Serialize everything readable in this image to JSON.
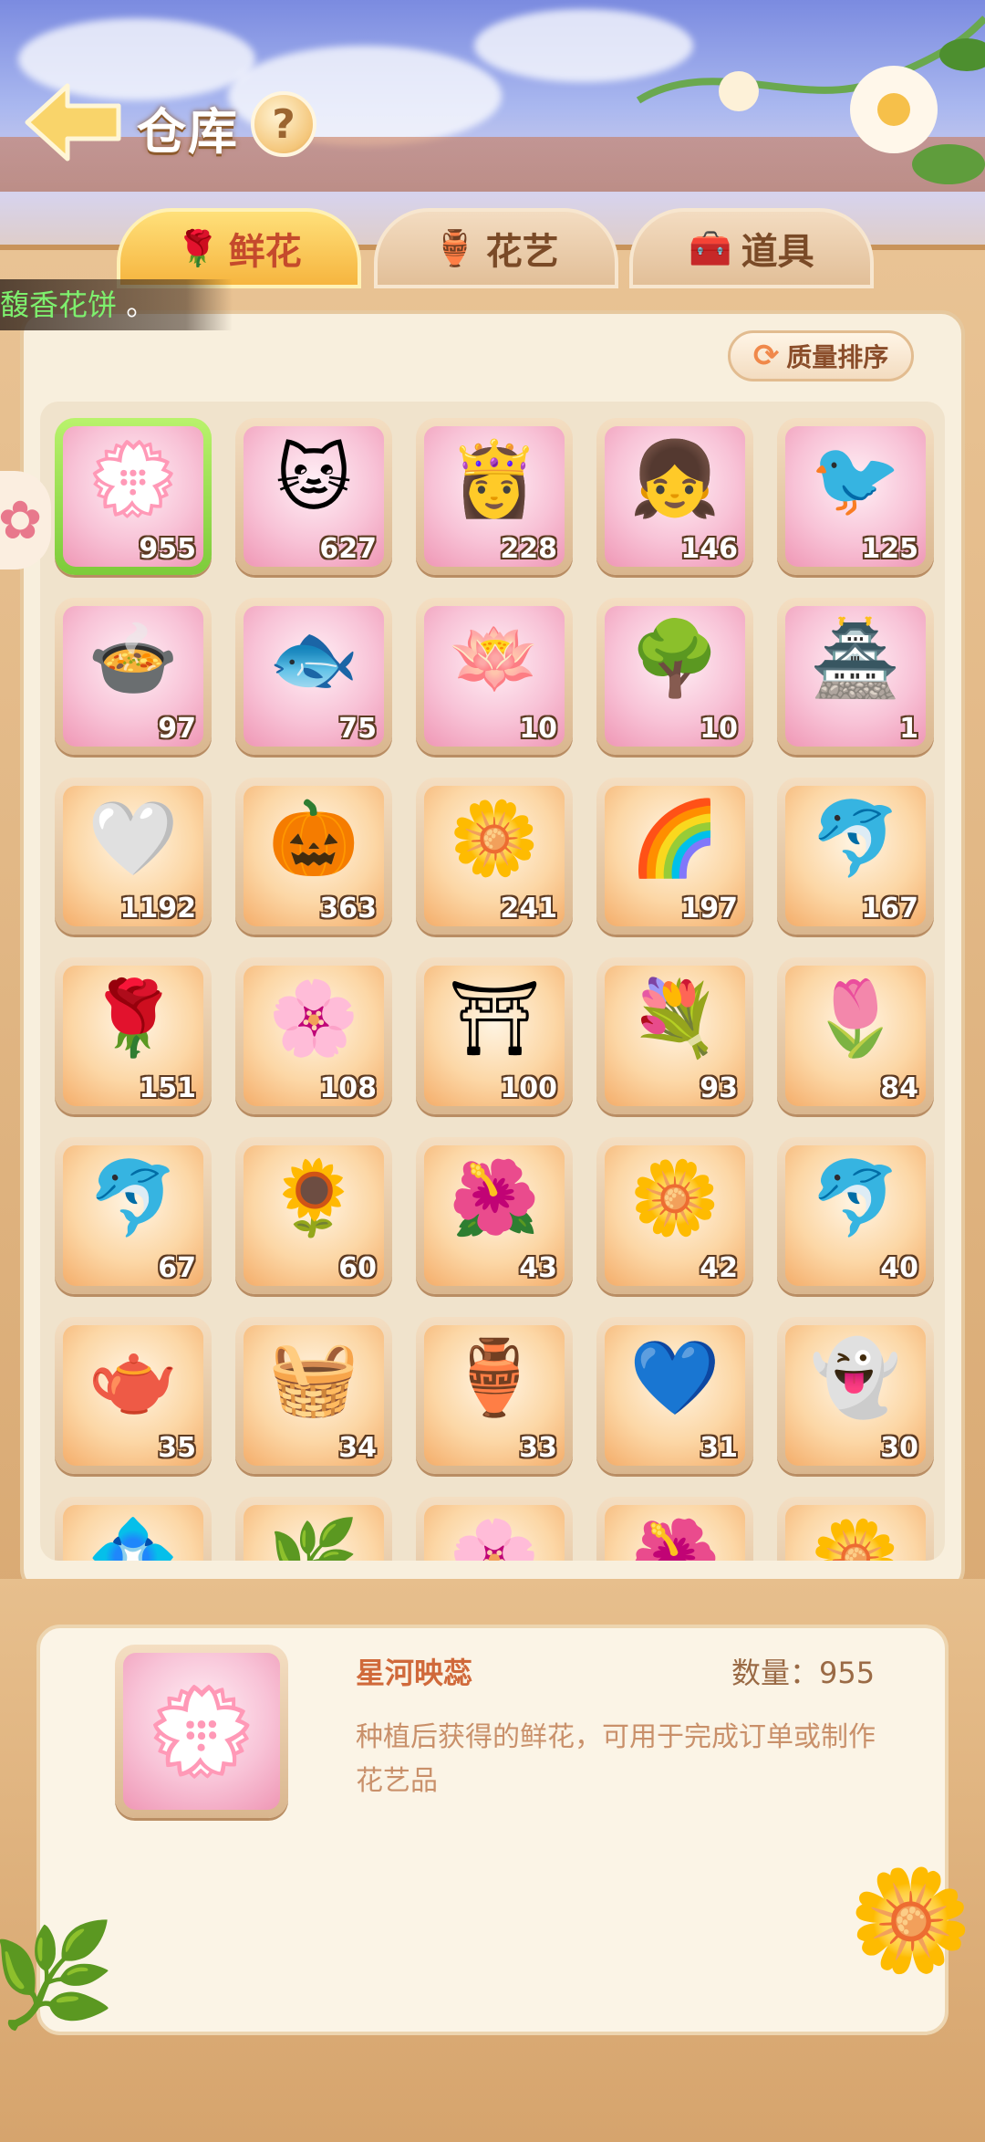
{
  "header": {
    "title": "仓库",
    "help": "?"
  },
  "tabs": [
    {
      "label": "鲜花",
      "icon": "🌹",
      "active": true
    },
    {
      "label": "花艺",
      "icon": "🏺",
      "active": false
    },
    {
      "label": "道具",
      "icon": "🧰",
      "active": false
    }
  ],
  "ticker": {
    "highlight": "馥香花饼",
    "suffix": " 。"
  },
  "sort_button": {
    "label": "质量排序"
  },
  "items": [
    {
      "count": "955",
      "emoji": "💮",
      "bg": "pink"
    },
    {
      "count": "627",
      "emoji": "🐱",
      "bg": "pink"
    },
    {
      "count": "228",
      "emoji": "👸",
      "bg": "pink"
    },
    {
      "count": "146",
      "emoji": "👧",
      "bg": "pink"
    },
    {
      "count": "125",
      "emoji": "🐦",
      "bg": "pink"
    },
    {
      "count": "97",
      "emoji": "🍲",
      "bg": "pink"
    },
    {
      "count": "75",
      "emoji": "🐟",
      "bg": "pink"
    },
    {
      "count": "10",
      "emoji": "🪷",
      "bg": "pink"
    },
    {
      "count": "10",
      "emoji": "🌳",
      "bg": "pink"
    },
    {
      "count": "1",
      "emoji": "🏯",
      "bg": "pink"
    },
    {
      "count": "1192",
      "emoji": "🤍",
      "bg": "orange"
    },
    {
      "count": "363",
      "emoji": "🎃",
      "bg": "orange"
    },
    {
      "count": "241",
      "emoji": "🌼",
      "bg": "orange"
    },
    {
      "count": "197",
      "emoji": "🌈",
      "bg": "orange"
    },
    {
      "count": "167",
      "emoji": "🐬",
      "bg": "orange"
    },
    {
      "count": "151",
      "emoji": "🌹",
      "bg": "orange"
    },
    {
      "count": "108",
      "emoji": "🌸",
      "bg": "orange"
    },
    {
      "count": "100",
      "emoji": "⛩",
      "bg": "orange"
    },
    {
      "count": "93",
      "emoji": "💐",
      "bg": "orange"
    },
    {
      "count": "84",
      "emoji": "🌷",
      "bg": "orange"
    },
    {
      "count": "67",
      "emoji": "🐬",
      "bg": "orange"
    },
    {
      "count": "60",
      "emoji": "🌻",
      "bg": "orange"
    },
    {
      "count": "43",
      "emoji": "🌺",
      "bg": "orange"
    },
    {
      "count": "42",
      "emoji": "🌼",
      "bg": "orange"
    },
    {
      "count": "40",
      "emoji": "🐬",
      "bg": "orange"
    },
    {
      "count": "35",
      "emoji": "🫖",
      "bg": "orange"
    },
    {
      "count": "34",
      "emoji": "🧺",
      "bg": "orange"
    },
    {
      "count": "33",
      "emoji": "🏺",
      "bg": "orange"
    },
    {
      "count": "31",
      "emoji": "💙",
      "bg": "orange"
    },
    {
      "count": "30",
      "emoji": "👻",
      "bg": "orange"
    },
    {
      "count": "",
      "emoji": "💠",
      "bg": "orange"
    },
    {
      "count": "",
      "emoji": "🌿",
      "bg": "orange"
    },
    {
      "count": "",
      "emoji": "🌸",
      "bg": "orange"
    },
    {
      "count": "",
      "emoji": "🌺",
      "bg": "orange"
    },
    {
      "count": "",
      "emoji": "🌼",
      "bg": "orange"
    }
  ],
  "detail": {
    "name": "星河映蕊",
    "quantity_label": "数量：955",
    "description": "种植后获得的鲜花，可用于完成订单或制作花艺品",
    "emoji": "💮"
  }
}
